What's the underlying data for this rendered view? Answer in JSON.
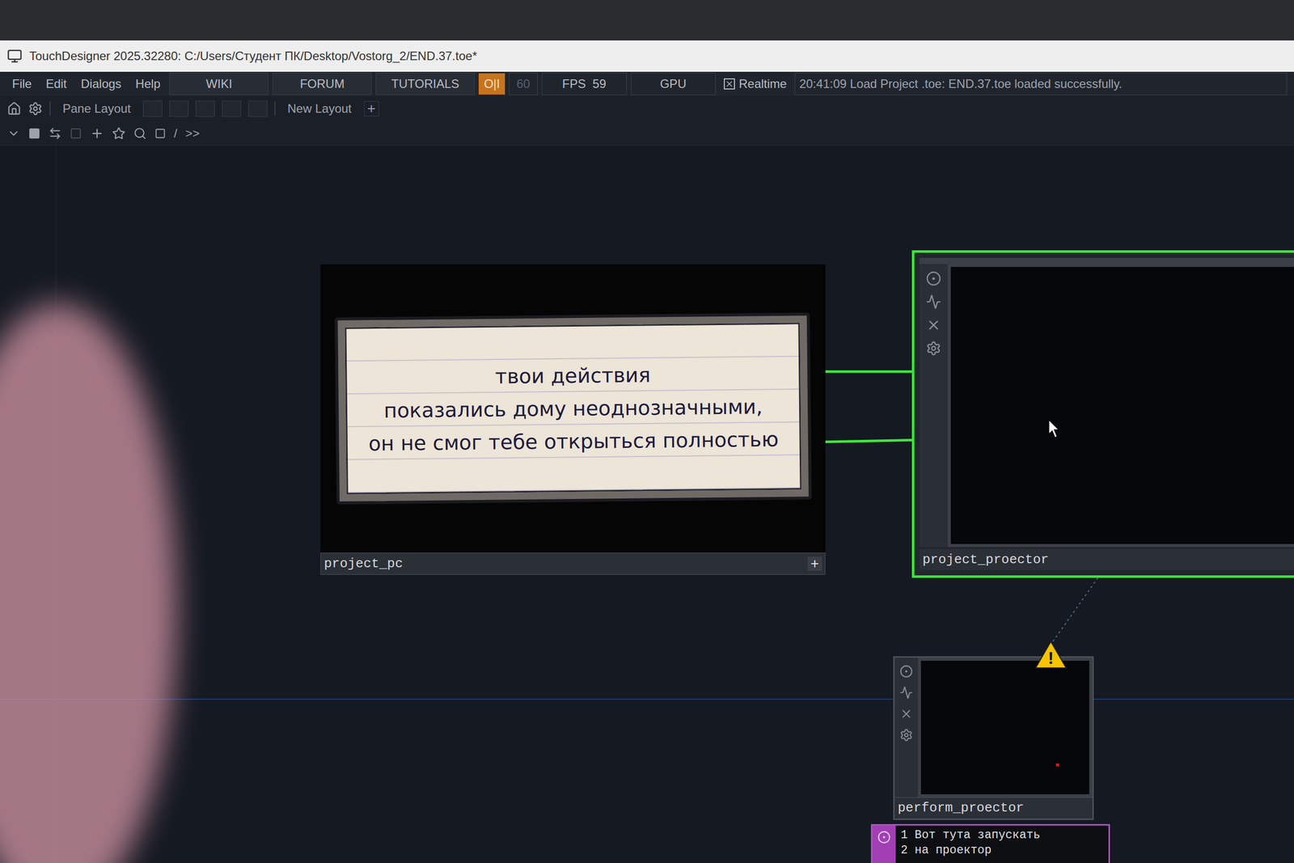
{
  "window": {
    "title": "TouchDesigner 2025.32280: C:/Users/Студент ПК/Desktop/Vostorg_2/END.37.toe*"
  },
  "menu": [
    "File",
    "Edit",
    "Dialogs",
    "Help"
  ],
  "links": [
    "WIKI",
    "FORUM",
    "TUTORIALS"
  ],
  "perf": {
    "label": "O|I",
    "active": true
  },
  "cook_rate": {
    "label": "60",
    "disabled": true
  },
  "fps": "FPS  59",
  "gpu": "GPU",
  "realtime": {
    "label": "Realtime",
    "checked": true
  },
  "status": "20:41:09 Load Project .toe: END.37.toe loaded successfully.",
  "toolbar": {
    "pane_layout": "Pane Layout",
    "new_layout": "New Layout",
    "add": "+"
  },
  "path": {
    "root": "/",
    "more": ">>"
  },
  "nodes": [
    {
      "name": "project_pc",
      "kind": "image",
      "selected": false,
      "corner": "+",
      "note": [
        "твои действия",
        "показались дому неоднозначными,",
        "он не смог тебе открыться полностью"
      ]
    },
    {
      "name": "project_proector",
      "kind": "viewer",
      "selected": true,
      "warning": false
    },
    {
      "name": "perform_proector",
      "kind": "viewer",
      "selected": false,
      "warning": true,
      "warning_mark": "!"
    }
  ],
  "text_dat": {
    "lines": [
      "1 Вот тута запускать",
      "2 на проектор"
    ]
  }
}
